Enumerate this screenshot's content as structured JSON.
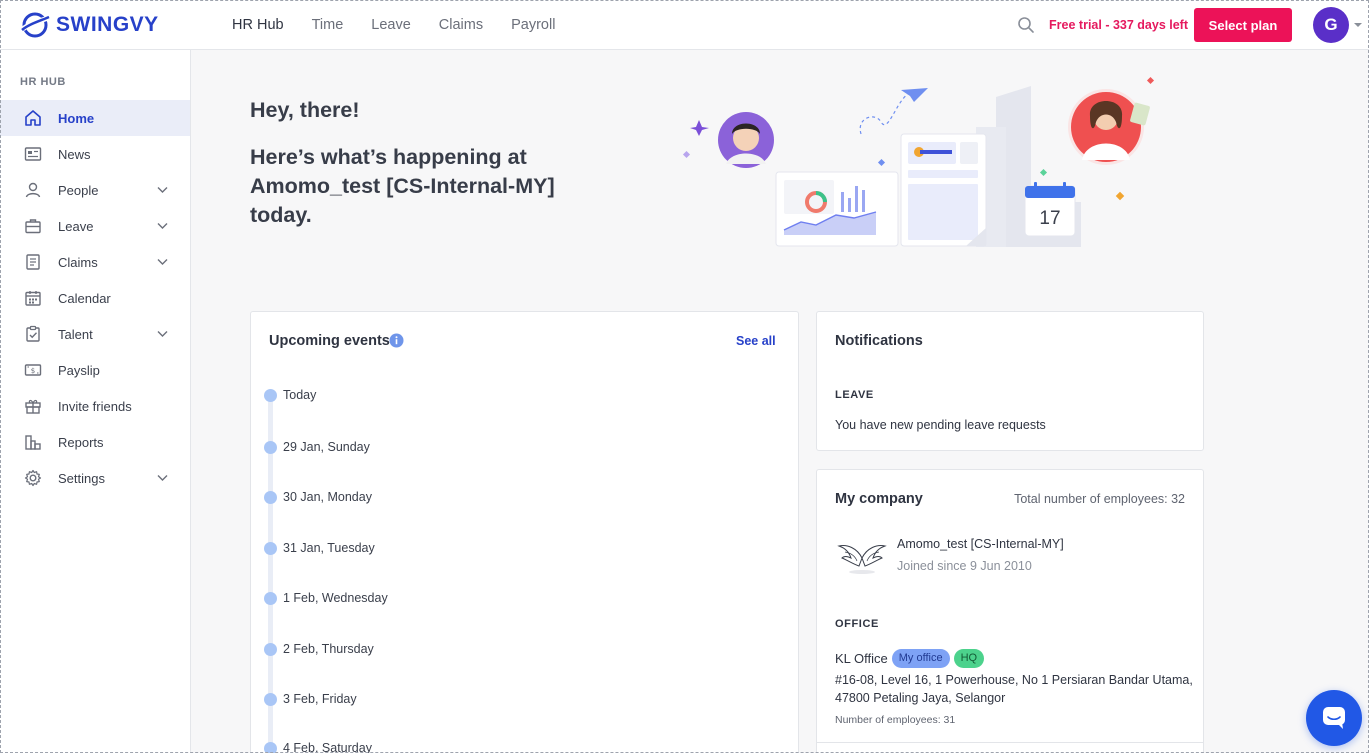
{
  "brand": {
    "name": "SWINGVY",
    "color": "#2741c9"
  },
  "topnav": [
    {
      "label": "HR Hub",
      "active": true
    },
    {
      "label": "Time",
      "active": false
    },
    {
      "label": "Leave",
      "active": false
    },
    {
      "label": "Claims",
      "active": false
    },
    {
      "label": "Payroll",
      "active": false
    }
  ],
  "header": {
    "trial_text": "Free trial - 337 days left",
    "select_plan_label": "Select plan",
    "avatar_initial": "G"
  },
  "sidebar": {
    "title": "HR HUB",
    "items": [
      {
        "label": "Home",
        "icon": "home-icon",
        "active": true,
        "expandable": false
      },
      {
        "label": "News",
        "icon": "news-icon",
        "active": false,
        "expandable": false
      },
      {
        "label": "People",
        "icon": "person-icon",
        "active": false,
        "expandable": true
      },
      {
        "label": "Leave",
        "icon": "briefcase-icon",
        "active": false,
        "expandable": true
      },
      {
        "label": "Claims",
        "icon": "receipt-icon",
        "active": false,
        "expandable": true
      },
      {
        "label": "Calendar",
        "icon": "calendar-icon",
        "active": false,
        "expandable": false
      },
      {
        "label": "Talent",
        "icon": "clipboard-check-icon",
        "active": false,
        "expandable": true
      },
      {
        "label": "Payslip",
        "icon": "money-icon",
        "active": false,
        "expandable": false
      },
      {
        "label": "Invite friends",
        "icon": "gift-icon",
        "active": false,
        "expandable": false
      },
      {
        "label": "Reports",
        "icon": "bar-chart-icon",
        "active": false,
        "expandable": false
      },
      {
        "label": "Settings",
        "icon": "gear-icon",
        "active": false,
        "expandable": true
      }
    ]
  },
  "hero": {
    "greeting": "Hey, there!",
    "subtitle": "Here’s what’s happening at Amomo_test [CS-Internal-MY] today.",
    "calendar_day": "17"
  },
  "events": {
    "title": "Upcoming events",
    "see_all_label": "See all",
    "items": [
      {
        "label": "Today"
      },
      {
        "label": "29 Jan, Sunday"
      },
      {
        "label": "30 Jan, Monday"
      },
      {
        "label": "31 Jan, Tuesday"
      },
      {
        "label": "1 Feb, Wednesday"
      },
      {
        "label": "2 Feb, Thursday"
      },
      {
        "label": "3 Feb, Friday"
      },
      {
        "label": "4 Feb, Saturday"
      }
    ]
  },
  "notifications": {
    "title": "Notifications",
    "section": "LEAVE",
    "message": "You have new pending leave requests"
  },
  "company": {
    "title": "My company",
    "total_employees": "Total number of employees: 32",
    "name": "Amomo_test [CS-Internal-MY]",
    "joined": "Joined since 9 Jun 2010",
    "office_section": "OFFICE",
    "office_name": "KL Office",
    "tag_my_office": "My office",
    "tag_hq": "HQ",
    "address": "#16-08, Level 16, 1 Powerhouse, No 1 Persiaran Bandar Utama, 47800 Petaling Jaya, Selangor",
    "office_employees": "Number of employees: 31"
  },
  "colors": {
    "accent": "#2741c9",
    "cta": "#ec1258",
    "trial": "#e5195e",
    "avatar": "#5a2fc8",
    "chat": "#2158e6"
  }
}
